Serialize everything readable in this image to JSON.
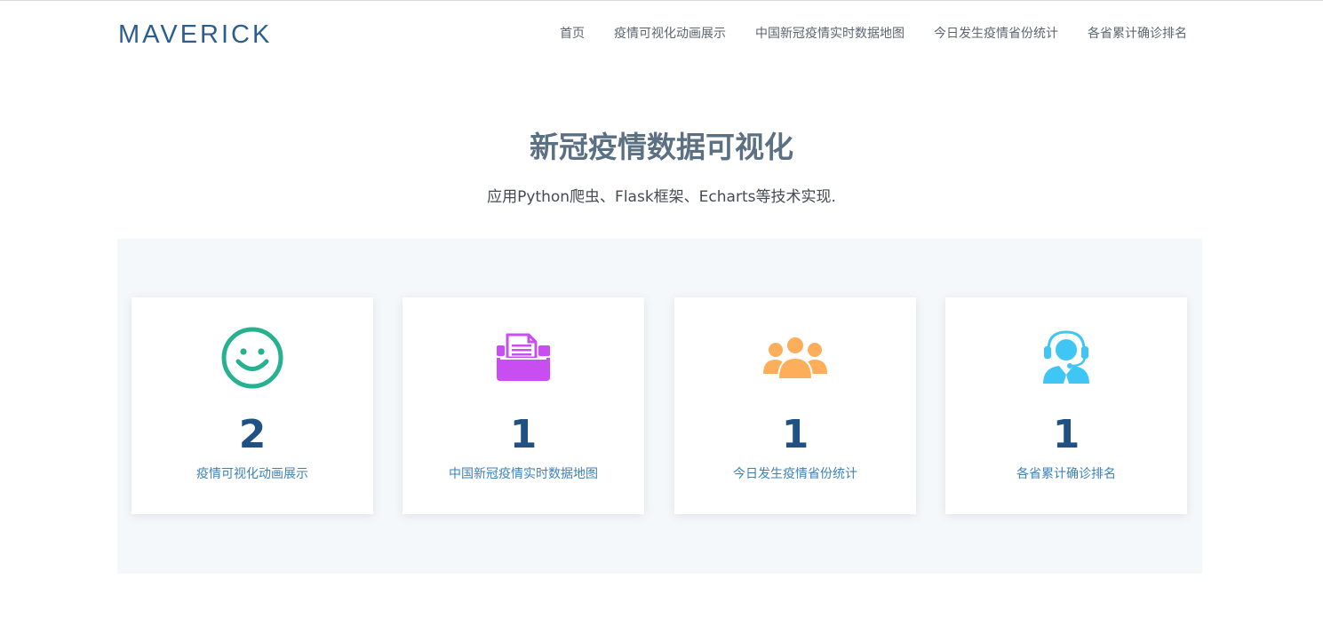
{
  "header": {
    "logo": "MAVERICK",
    "nav": [
      {
        "label": "首页"
      },
      {
        "label": "疫情可视化动画展示"
      },
      {
        "label": "中国新冠疫情实时数据地图"
      },
      {
        "label": "今日发生疫情省份统计"
      },
      {
        "label": "各省累计确诊排名"
      }
    ]
  },
  "hero": {
    "title": "新冠疫情数据可视化",
    "subtitle": "应用Python爬虫、Flask框架、Echarts等技术实现."
  },
  "cards": [
    {
      "icon": "smiley-icon",
      "color": "#27b28f",
      "count": "2",
      "label": "疫情可视化动画展示"
    },
    {
      "icon": "inbox-document-icon",
      "color": "#c94ef2",
      "count": "1",
      "label": "中国新冠疫情实时数据地图"
    },
    {
      "icon": "user-group-icon",
      "color": "#fcae5a",
      "count": "1",
      "label": "今日发生疫情省份统计"
    },
    {
      "icon": "headset-agent-icon",
      "color": "#3fc6f5",
      "count": "1",
      "label": "各省累计确诊排名"
    }
  ]
}
